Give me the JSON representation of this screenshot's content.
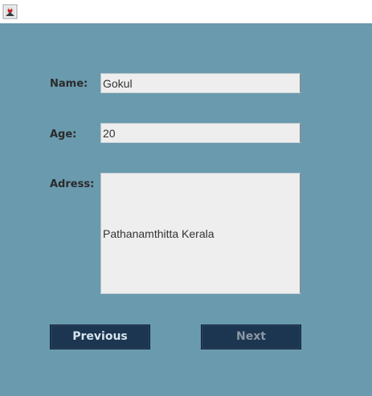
{
  "window": {
    "icon": "java-app-icon"
  },
  "form": {
    "name_label": "Name:",
    "name_value": "Gokul",
    "age_label": "Age:",
    "age_value": "20",
    "address_label": "Adress:",
    "address_value": "Pathanamthitta Kerala"
  },
  "buttons": {
    "previous_label": "Previous",
    "next_label": "Next"
  },
  "colors": {
    "panel_background": "#6a9aae",
    "button_background": "#1c3550",
    "field_background": "#eeeeee"
  }
}
